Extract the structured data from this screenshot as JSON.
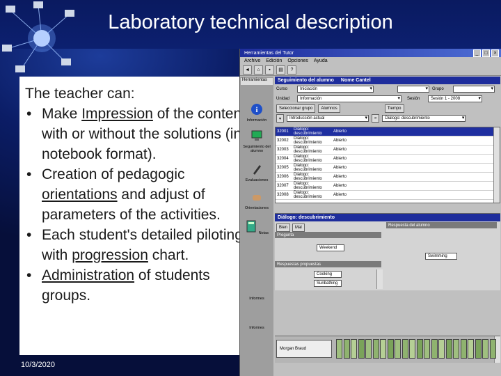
{
  "slide": {
    "title": "Laboratory technical description",
    "date": "10/3/2020",
    "lead": "The teacher can:",
    "bullets": [
      {
        "pre": "Make ",
        "u": "Impression",
        "post": " of the content with or without the solutions (in notebook format)."
      },
      {
        "pre": "Creation of pedagogic ",
        "u": "orientations",
        "post": " and adjust of parameters of the activities."
      },
      {
        "pre": "Each student's detailed piloting with ",
        "u": "progression",
        "post": " chart."
      },
      {
        "pre": "",
        "u": "Administration",
        "post": " of students groups."
      }
    ]
  },
  "app": {
    "window_title": "Herramientas del Tutor",
    "menu": [
      "Archivo",
      "Edición",
      "Opciones",
      "Ayuda"
    ],
    "toolbar_icons": [
      "back-icon",
      "home-icon",
      "save-icon",
      "print-icon",
      "help-icon"
    ],
    "sidebar": {
      "header": "Herramientas",
      "items": [
        {
          "label": "Información",
          "icon": "info-icon"
        },
        {
          "label": "Seguimiento del alumno",
          "icon": "monitor-icon"
        },
        {
          "label": "Evaluaciones",
          "icon": "pen-icon"
        },
        {
          "label": "Orientaciones",
          "icon": "hand-icon"
        },
        {
          "label": "Notas",
          "icon": "calculator-icon"
        },
        {
          "label": "Informes",
          "icon": "report-icon"
        },
        {
          "label": "Informes",
          "icon": "report-icon"
        }
      ]
    },
    "tracking": {
      "header": "Seguimiento del alumno",
      "student_name": "Nome Cantel",
      "row1_label": "Curso",
      "row1_value": "Iniciación",
      "row1_right": "Grupo",
      "row2_label": "Unidad",
      "row2_value": "Información",
      "row2_right": "Sesión",
      "row2_right_value": "Sesión 1 - 2008",
      "links": [
        "Seleccionar grupo",
        "Alumnos",
        "Tiempo"
      ],
      "filter_value": "Introducción actual",
      "activity_filter": "Diálogo: descubrimiento"
    },
    "table_rows": [
      {
        "id": "32001",
        "act": "Diálogo: descubrimiento",
        "state": "Abierto",
        "selected": true
      },
      {
        "id": "32002",
        "act": "Diálogo: descubrimiento",
        "state": "Abierto",
        "selected": false
      },
      {
        "id": "32003",
        "act": "Diálogo: descubrimiento",
        "state": "Abierto",
        "selected": false
      },
      {
        "id": "32004",
        "act": "Diálogo: descubrimiento",
        "state": "Abierto",
        "selected": false
      },
      {
        "id": "32005",
        "act": "Diálogo: descubrimiento",
        "state": "Abierto",
        "selected": false
      },
      {
        "id": "32006",
        "act": "Diálogo: descubrimiento",
        "state": "Abierto",
        "selected": false
      },
      {
        "id": "32007",
        "act": "Diálogo: descubrimiento",
        "state": "Abierto",
        "selected": false
      },
      {
        "id": "32008",
        "act": "Diálogo: descubrimiento",
        "state": "Abierto",
        "selected": false
      }
    ],
    "dialog": {
      "header": "Diálogo: descubrimiento",
      "tab_bien": "Bien",
      "tab_mal": "Mal",
      "answer_header": "Respuesta del alumno",
      "question_label": "Pregunta",
      "question_value": "Weekend",
      "answer_value": "Swimming",
      "proposed_label": "Respuestas propuestas",
      "proposed": [
        "Cooking",
        "Sunbathing"
      ]
    },
    "bottom": {
      "student": "Morgan Braud",
      "tile_count": 22
    }
  }
}
